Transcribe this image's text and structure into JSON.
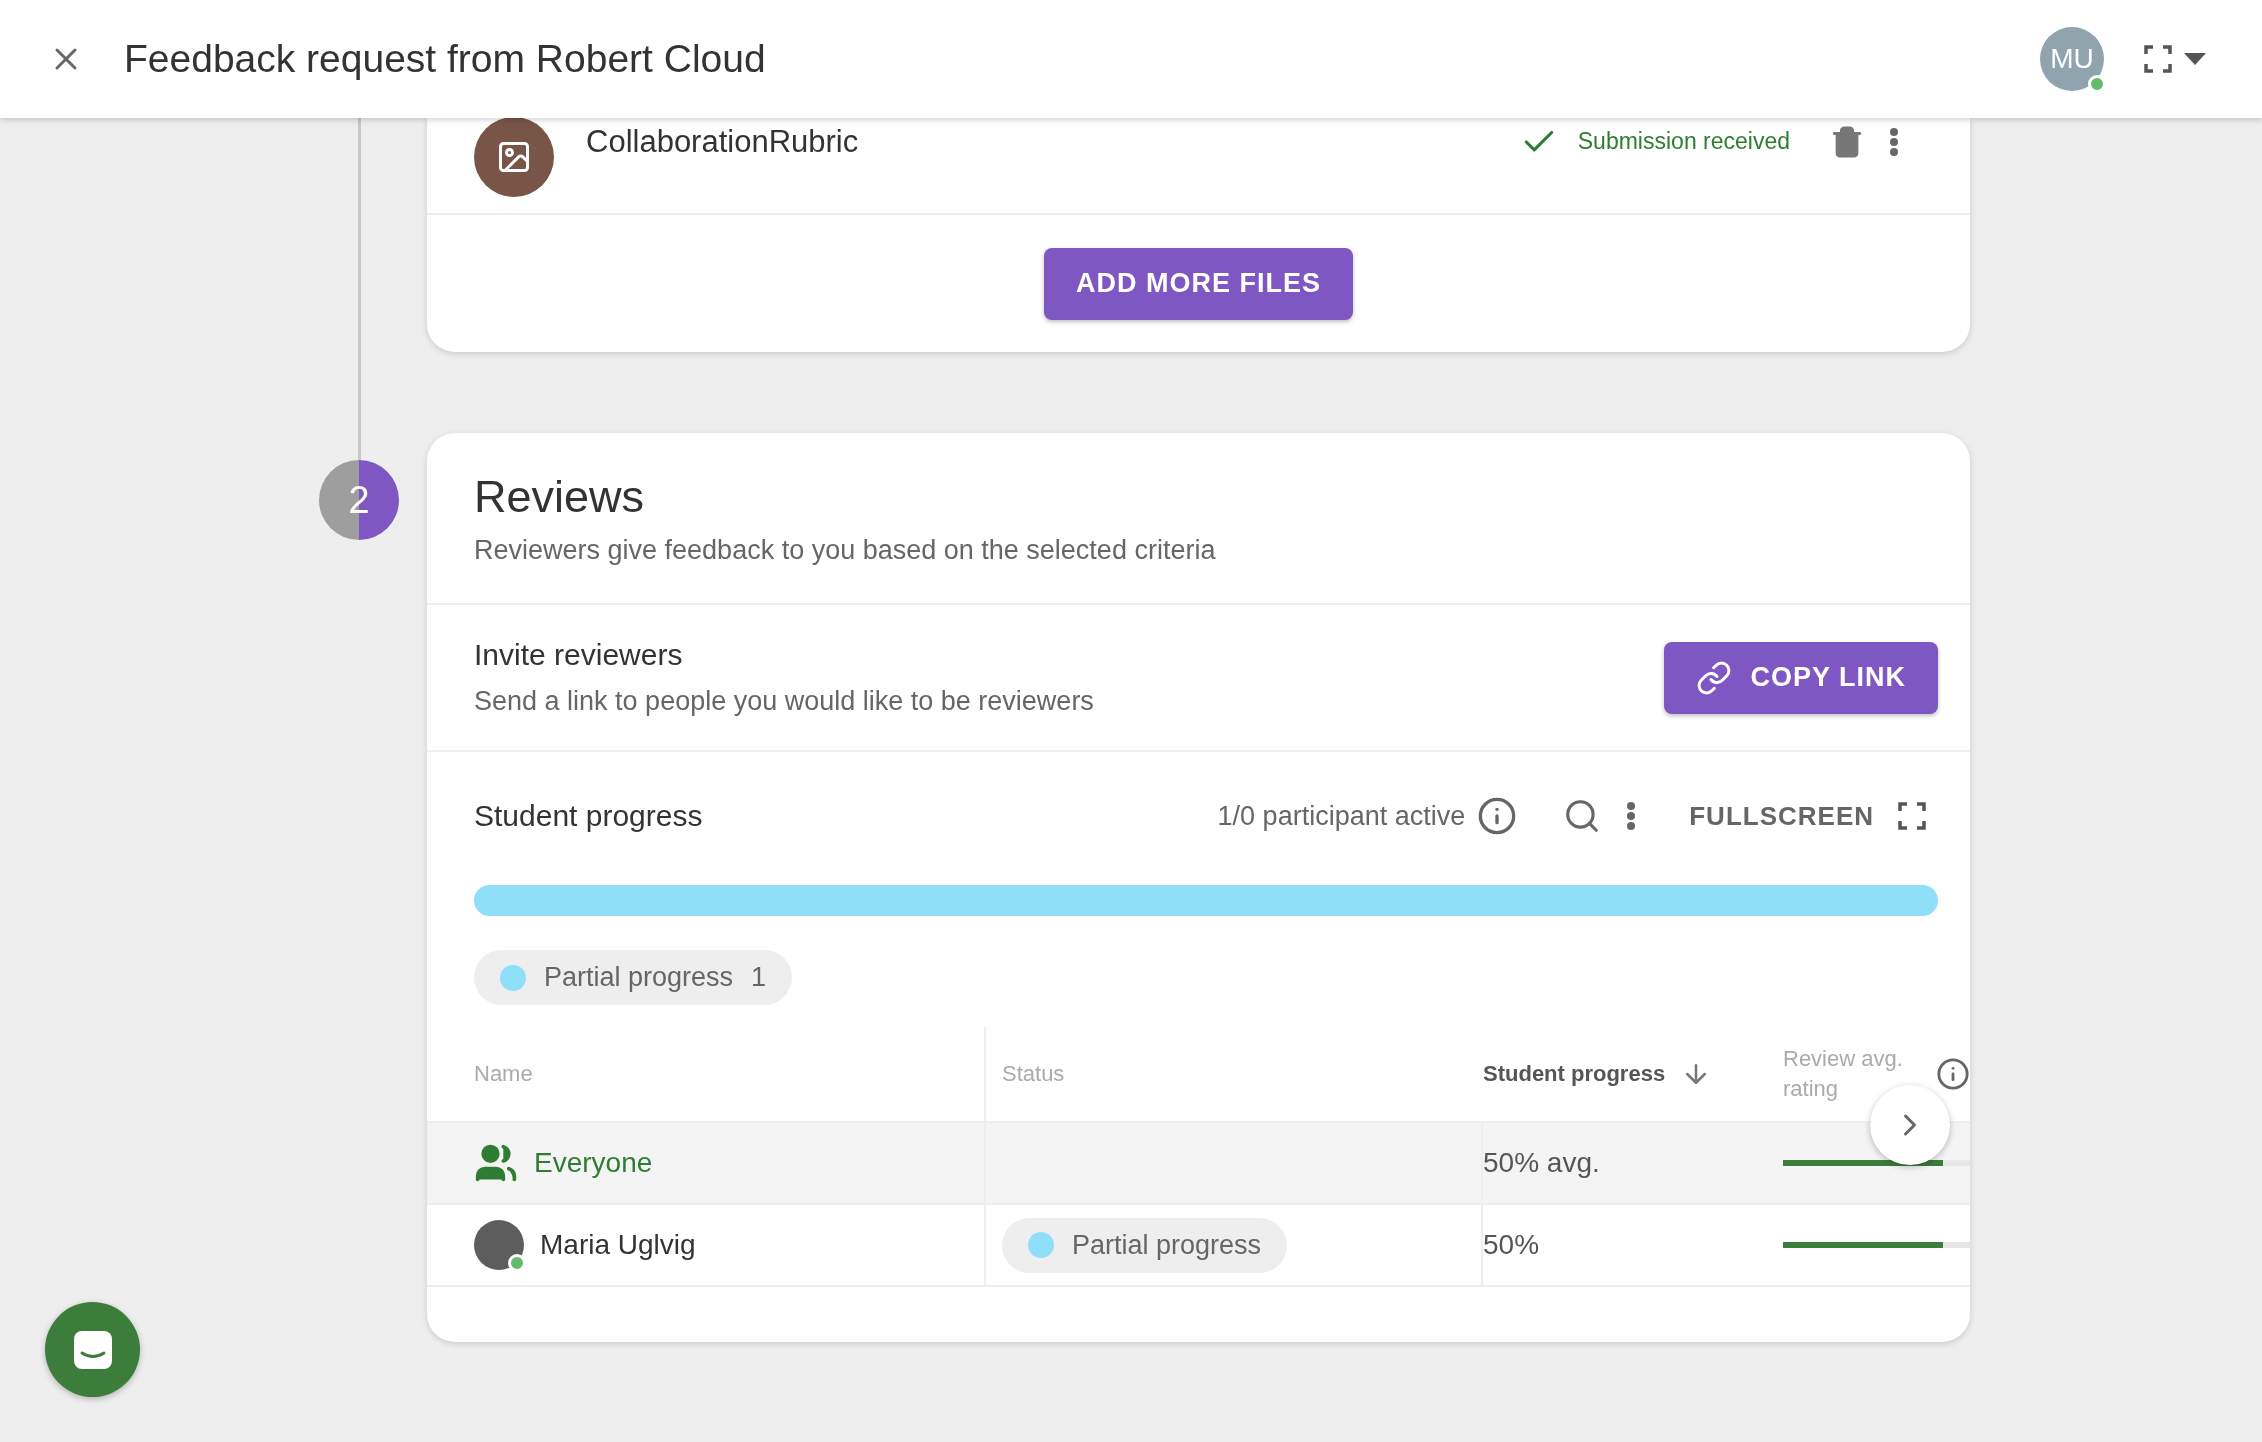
{
  "header": {
    "title": "Feedback request from Robert Cloud",
    "avatar_initials": "MU",
    "online": true
  },
  "files": [
    {
      "name": "CollaborationRubric",
      "status": "Submission received"
    }
  ],
  "add_files_button": "ADD MORE FILES",
  "step": {
    "number": "2"
  },
  "reviews": {
    "title": "Reviews",
    "subtitle": "Reviewers give feedback to you based on the selected criteria"
  },
  "invite": {
    "title": "Invite reviewers",
    "subtitle": "Send a link to people you would like to be reviewers",
    "button": "COPY LINK"
  },
  "progress": {
    "title": "Student progress",
    "active_text": "1/0 participant active",
    "fullscreen_label": "FULLSCREEN",
    "level": 1,
    "legend": [
      {
        "label": "Partial progress",
        "count": "1",
        "color": "#90dff9"
      }
    ]
  },
  "table": {
    "columns": [
      {
        "label": "Name",
        "sorted": false
      },
      {
        "label": "Status",
        "sorted": false
      },
      {
        "label": "Student progress",
        "sorted": true
      },
      {
        "label": "Review avg. rating",
        "sorted": false
      }
    ],
    "rows": [
      {
        "kind": "group",
        "name": "Everyone",
        "progress": "50% avg.",
        "level": 0.8
      },
      {
        "kind": "person",
        "name": "Maria Uglvig",
        "online": true,
        "status": {
          "label": "Partial progress",
          "color": "#90dff9"
        },
        "progress": "50%",
        "level": 0.8
      }
    ]
  }
}
